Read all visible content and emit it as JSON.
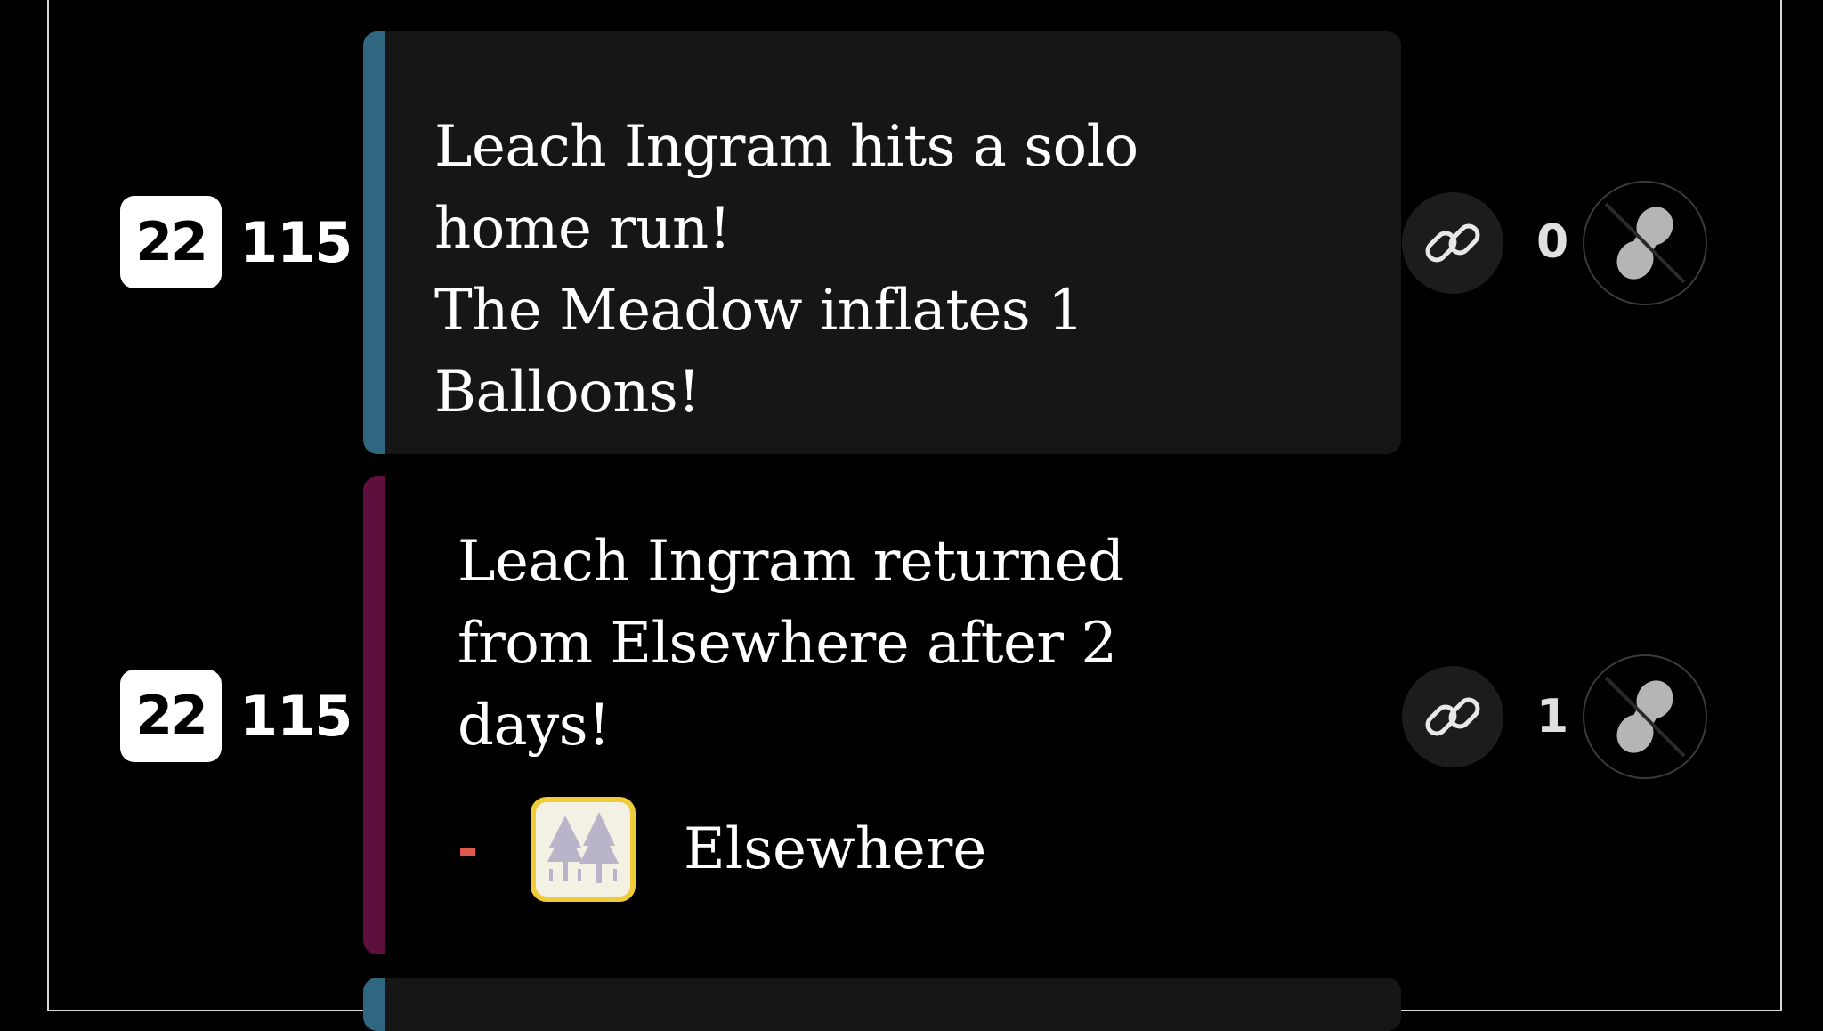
{
  "events": [
    {
      "season": "22",
      "day": "115",
      "bar_color": "#2f6680",
      "card_bg": "#161616",
      "lines": [
        "Leach Ingram hits a solo",
        "home run!",
        "The Meadow inflates 1",
        "Balloons!"
      ],
      "vote_count": "0",
      "link_icon": "link-icon",
      "peanut_icon": "peanut-crossed-icon"
    },
    {
      "season": "22",
      "day": "115",
      "bar_color": "#5e0f3e",
      "card_bg": "#000000",
      "lines": [
        "Leach Ingram returned",
        "from Elsewhere after 2",
        "days!"
      ],
      "tag": {
        "dash": "-",
        "team_icon": "forest-icon",
        "label": "Elsewhere"
      },
      "vote_count": "1",
      "link_icon": "link-icon",
      "peanut_icon": "peanut-crossed-icon"
    }
  ],
  "colors": {
    "background": "#000000",
    "frame": "#d8d8d8",
    "tag_border": "#f1cc3a",
    "dash": "#e05a4e"
  }
}
